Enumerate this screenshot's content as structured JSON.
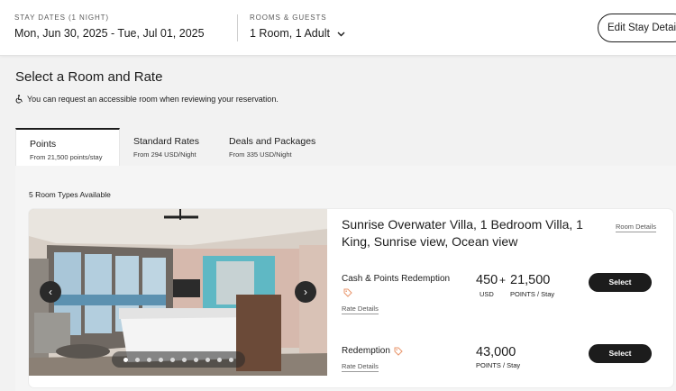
{
  "header": {
    "stay_label": "STAY DATES (1 NIGHT)",
    "stay_value": "Mon, Jun 30, 2025 - Tue, Jul 01, 2025",
    "guests_label": "ROOMS & GUESTS",
    "guests_value": "1 Room, 1 Adult",
    "edit_button": "Edit Stay Details"
  },
  "page_title": "Select a Room and Rate",
  "accessible_note": "You can request an accessible room when reviewing your reservation.",
  "tabs": [
    {
      "title": "Points",
      "subtitle": "From 21,500 points/stay"
    },
    {
      "title": "Standard Rates",
      "subtitle": "From 294 USD/Night"
    },
    {
      "title": "Deals and Packages",
      "subtitle": "From 335 USD/Night"
    }
  ],
  "room_count": "5 Room Types Available",
  "room": {
    "name": "Sunrise Overwater Villa, 1 Bedroom Villa, 1 King, Sunrise view, Ocean view",
    "details_link": "Room Details",
    "photo_dots": 10,
    "active_dot": 0,
    "rates": [
      {
        "name": "Cash & Points Redemption",
        "details_link": "Rate Details",
        "cash_amount": "450",
        "cash_unit": "USD",
        "plus": "+",
        "points_amount": "21,500",
        "points_unit": "POINTS / Stay",
        "select": "Select"
      },
      {
        "name": "Redemption",
        "details_link": "Rate Details",
        "points_amount": "43,000",
        "points_unit": "POINTS / Stay",
        "select": "Select"
      }
    ]
  },
  "colors": {
    "accent_tag": "#e8956b",
    "button": "#1c1c1c"
  },
  "icons": [
    "accessible-icon",
    "chevron-down-icon",
    "tag-icon",
    "arrow-left-icon",
    "arrow-right-icon"
  ]
}
